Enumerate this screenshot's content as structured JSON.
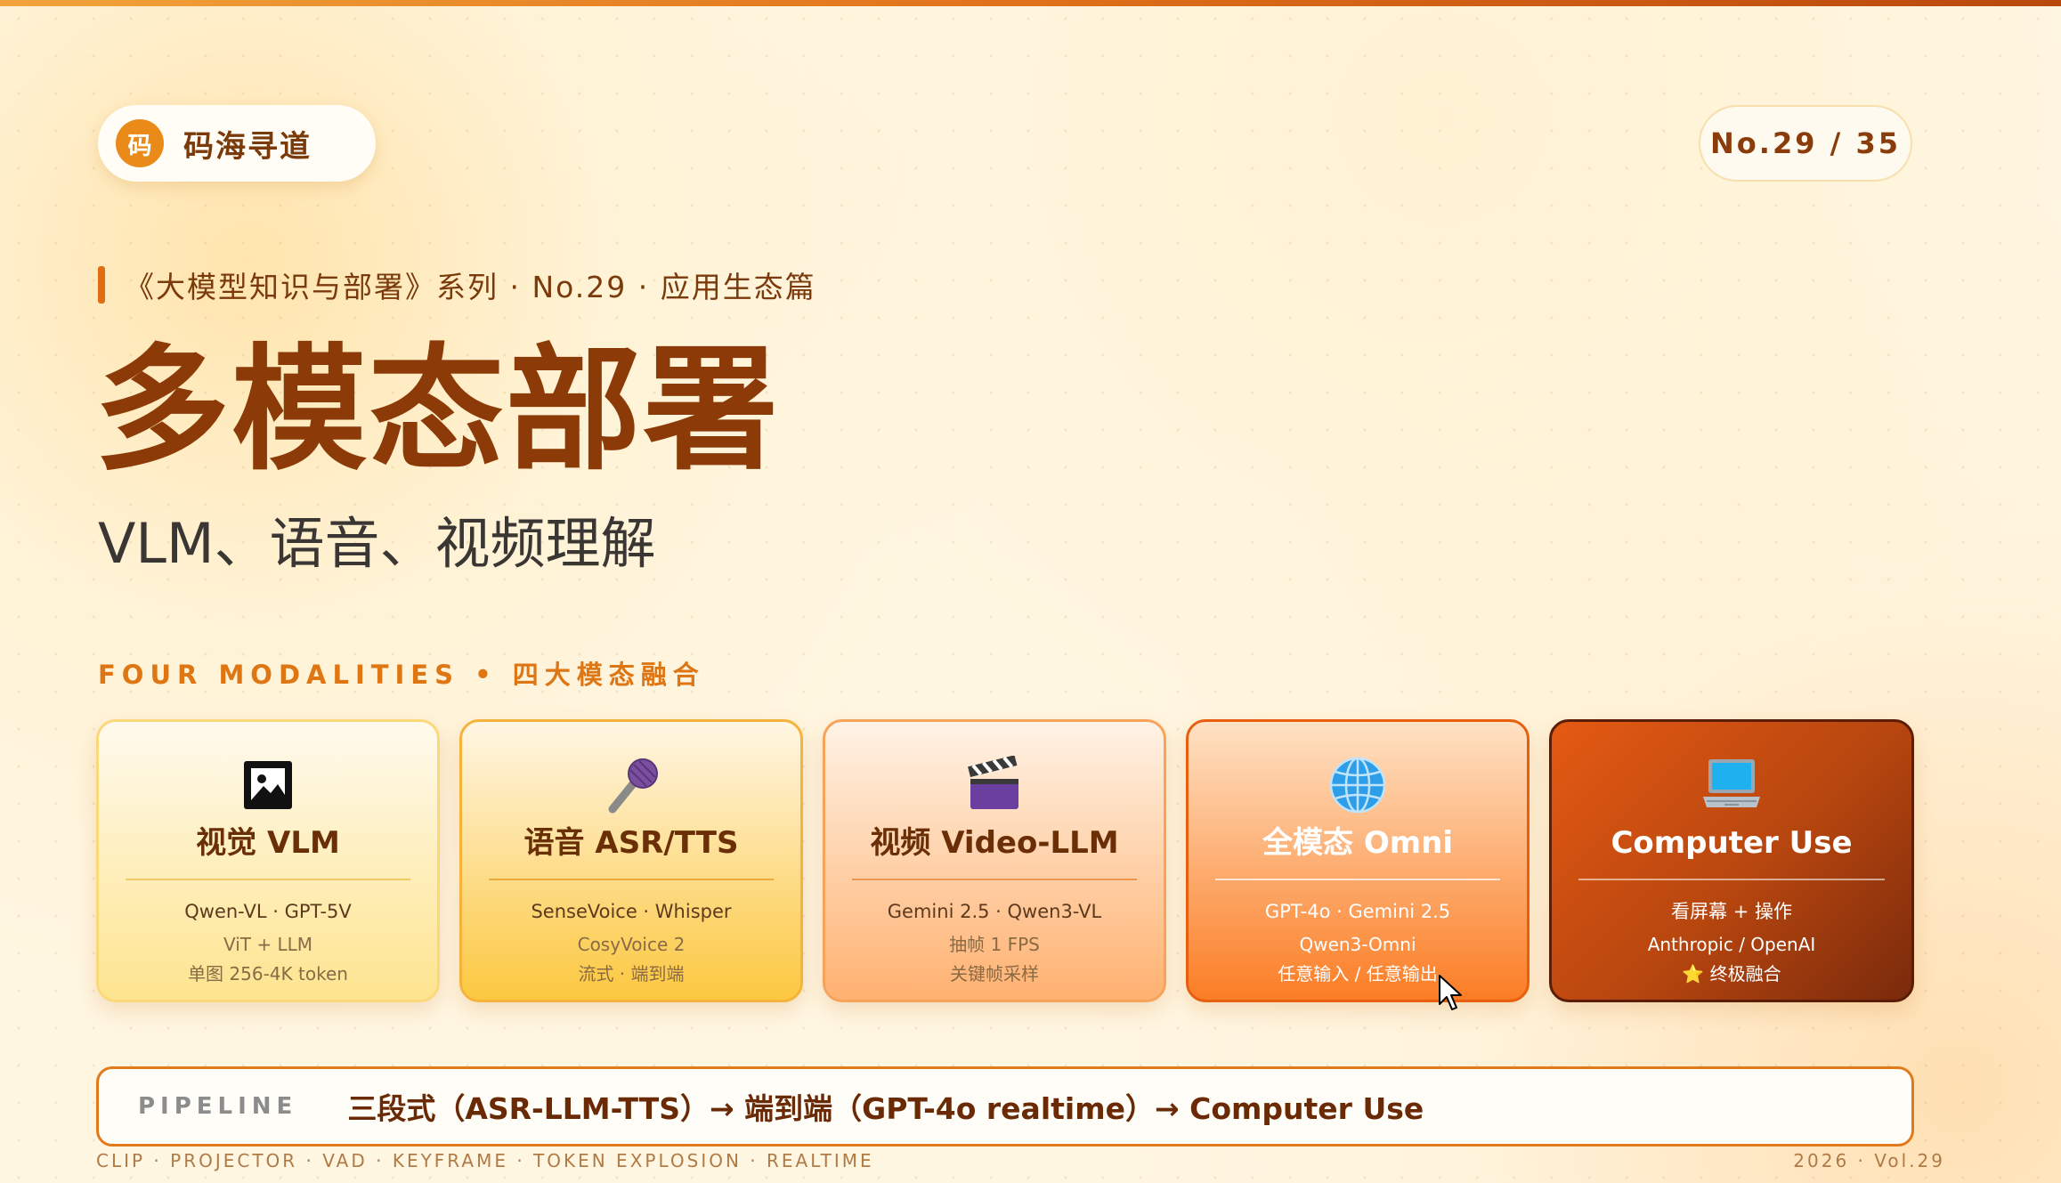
{
  "brand": {
    "logo_char": "码",
    "name": "码海寻道"
  },
  "pager": {
    "text": "No.29 / 35"
  },
  "series": {
    "text": "《大模型知识与部署》系列 · No.29 · 应用生态篇"
  },
  "title": "多模态部署",
  "subtitle": "VLM、语音、视频理解",
  "section_label": "FOUR MODALITIES • 四大模态融合",
  "cards": [
    {
      "icon": "picture-frame-icon",
      "title": "视觉 VLM",
      "line1": "Qwen-VL · GPT-5V",
      "line2": "ViT + LLM",
      "line3": "单图 256-4K token"
    },
    {
      "icon": "microphone-icon",
      "title": "语音 ASR/TTS",
      "line1": "SenseVoice · Whisper",
      "line2": "CosyVoice 2",
      "line3": "流式 · 端到端"
    },
    {
      "icon": "clapper-board-icon",
      "title": "视频 Video-LLM",
      "line1": "Gemini 2.5 · Qwen3-VL",
      "line2": "抽帧 1 FPS",
      "line3": "关键帧采样"
    },
    {
      "icon": "globe-icon",
      "title": "全模态 Omni",
      "line1": "GPT-4o · Gemini 2.5",
      "line2": "Qwen3-Omni",
      "line3": "任意输入 / 任意输出"
    },
    {
      "icon": "laptop-icon",
      "title": "Computer Use",
      "line1": "看屏幕 + 操作",
      "line2": "Anthropic / OpenAI",
      "line3": "⭐ 终极融合"
    }
  ],
  "pipeline": {
    "label": "PIPELINE",
    "text": "三段式（ASR-LLM-TTS）→ 端到端（GPT-4o realtime）→ Computer Use"
  },
  "footer": {
    "left": "CLIP · PROJECTOR · VAD · KEYFRAME · TOKEN EXPLOSION · REALTIME",
    "right": "2026 · Vol.29"
  },
  "colors": {
    "accent": "#e06d10",
    "title": "#8c3a07",
    "dark_card": "#b7460f"
  }
}
